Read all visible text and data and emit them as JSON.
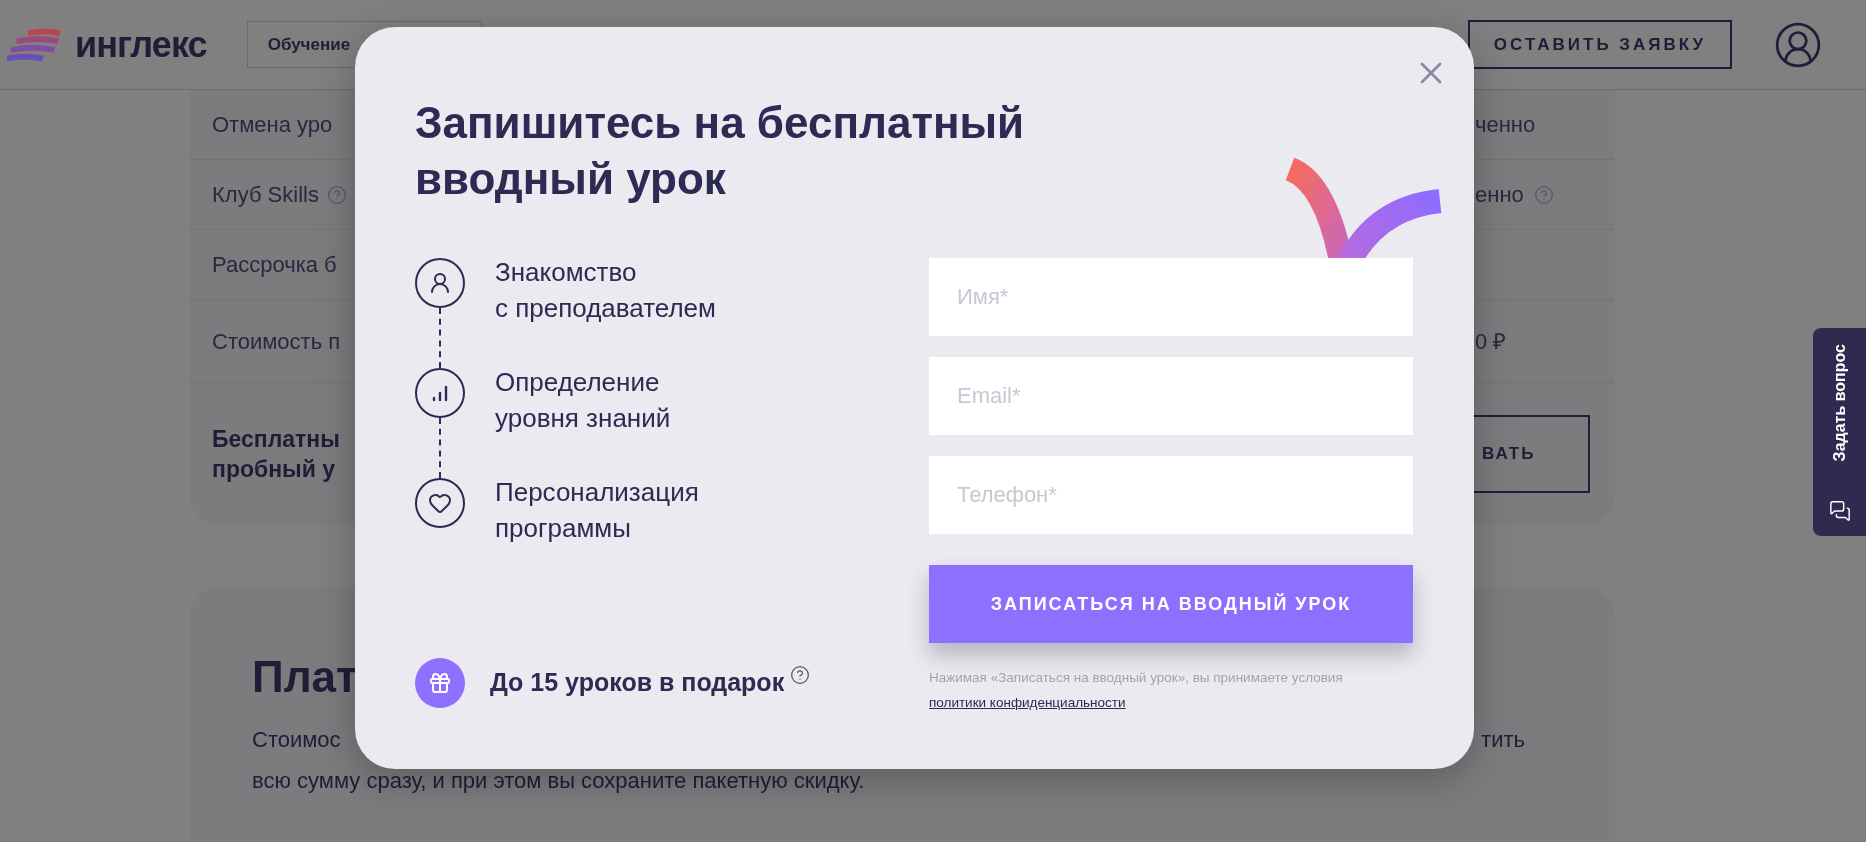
{
  "header": {
    "logo": "инглекс",
    "nav_button": "Обучение",
    "cta_button": "ОСТАВИТЬ ЗАЯВКУ"
  },
  "background_table": {
    "rows": [
      {
        "label": "Отмена уро",
        "label_help": false,
        "value": "ченно",
        "value_help": false
      },
      {
        "label": "Клуб Skills",
        "label_help": true,
        "value": "енно",
        "value_help": true
      },
      {
        "label": "Рассрочка б",
        "label_help": false,
        "value_help": false
      },
      {
        "label": "Стоимость п",
        "label_help": false,
        "value": "0 ₽",
        "value_help": false
      }
    ],
    "trial_lines": [
      "Бесплатны",
      "пробный у"
    ],
    "trial_button": "ВАТЬ"
  },
  "paid_section": {
    "title": "Плат",
    "text_left": "Стоимос",
    "text_right": "тить",
    "text_line2": "всю сумму сразу, и при этом вы сохраните пакетную скидку."
  },
  "side_tab": "Задать вопрос",
  "modal": {
    "title_lines": [
      "Запишитесь на бесплатный",
      "вводный урок"
    ],
    "steps": [
      {
        "kind": "person",
        "lines": [
          "Знакомство",
          "с преподавателем"
        ]
      },
      {
        "kind": "chart",
        "lines": [
          "Определение",
          "уровня знаний"
        ]
      },
      {
        "kind": "heart",
        "lines": [
          "Персонализация",
          "программы"
        ]
      }
    ],
    "bonus": "До 15 уроков в подарок",
    "fields": [
      {
        "placeholder": "Имя*"
      },
      {
        "placeholder": "Email*"
      },
      {
        "placeholder": "Телефон*"
      }
    ],
    "submit": "ЗАПИСАТЬСЯ НА ВВОДНЫЙ УРОК",
    "consent": "Нажимая «Записаться на вводный урок», вы принимаете условия",
    "consent_link": "политики конфиденциальности"
  }
}
